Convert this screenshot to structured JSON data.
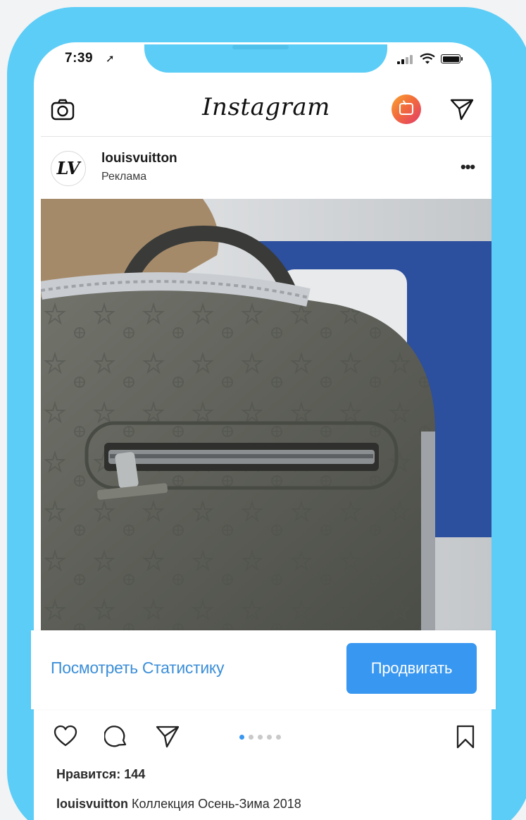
{
  "status_bar": {
    "time": "7:39",
    "location_icon": "location-arrow-icon",
    "signal_icon": "cellular-signal-icon",
    "wifi_icon": "wifi-icon",
    "battery_icon": "battery-icon"
  },
  "header": {
    "logo": "Instagram",
    "camera_icon": "camera-icon",
    "igtv_icon": "igtv-icon",
    "direct_icon": "direct-message-icon"
  },
  "post": {
    "avatar_text": "LV",
    "username": "louisvuitton",
    "sponsored_label": "Реклама",
    "more_icon": "more-options-icon",
    "image_description": "product-photo"
  },
  "insights_bar": {
    "view_insights_label": "Посмотреть Статистику",
    "promote_label": "Продвигать"
  },
  "actions": {
    "like_icon": "heart-icon",
    "comment_icon": "comment-icon",
    "share_icon": "share-icon",
    "save_icon": "bookmark-icon",
    "carousel_total": 5,
    "carousel_active": 1
  },
  "likes_text": "Нравится: 144",
  "caption": {
    "username": "louisvuitton",
    "text": "Коллекция Осень-Зима 2018"
  },
  "colors": {
    "frame": "#5ccdf6",
    "accent_blue": "#3897f0",
    "link_blue": "#3c8fd8"
  }
}
